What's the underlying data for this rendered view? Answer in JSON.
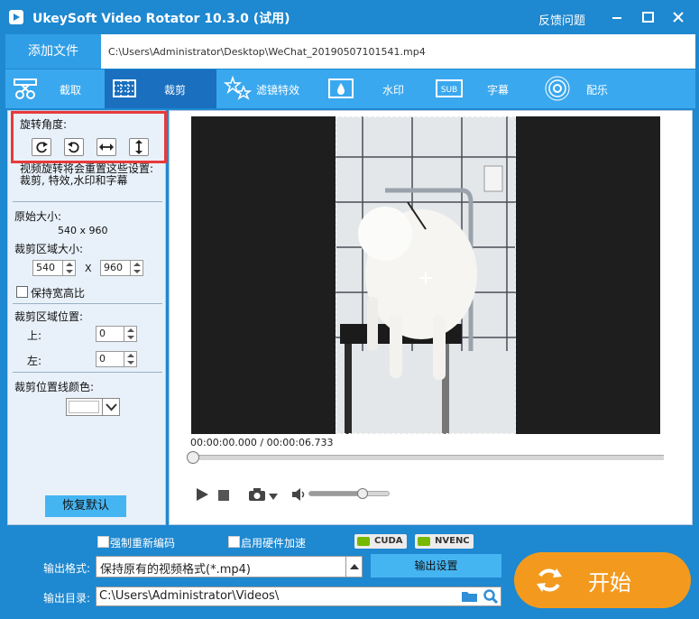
{
  "window": {
    "title": "UkeySoft Video Rotator 10.3.0 (试用)",
    "feedback": "反馈问题"
  },
  "file": {
    "add_label": "添加文件",
    "path": "C:\\Users\\Administrator\\Desktop\\WeChat_20190507101541.mp4"
  },
  "toolbar": {
    "tabs": [
      {
        "label": "截取",
        "icon": "film-scissors-icon"
      },
      {
        "label": "裁剪",
        "icon": "crop-icon",
        "active": true
      },
      {
        "label": "滤镜特效",
        "icon": "sparkle-effects-icon"
      },
      {
        "label": "水印",
        "icon": "water-drop-icon"
      },
      {
        "label": "字幕",
        "icon": "subtitle-icon"
      },
      {
        "label": "配乐",
        "icon": "music-icon"
      }
    ]
  },
  "left": {
    "rotation_label": "旋转角度:",
    "rotation_note_1": "视频旋转将会重置这些设置:",
    "rotation_note_2": "裁剪, 特效,水印和字幕",
    "original_size_label": "原始大小:",
    "original_size_value": "540 x 960",
    "crop_area_size_label": "裁剪区域大小:",
    "crop_width": "540",
    "crop_x": "X",
    "crop_height": "960",
    "keep_ratio_label": "保持宽高比",
    "crop_position_label": "裁剪区域位置:",
    "top_label": "上:",
    "top_value": "0",
    "left_label": "左:",
    "left_value": "0",
    "line_color_label": "裁剪位置线颜色:",
    "reset_label": "恢复默认"
  },
  "preview": {
    "timecode": "00:00:00.000 / 00:00:06.733",
    "volume_level": 0.67
  },
  "bottom": {
    "force_reencode": "强制重新编码",
    "hw_accel": "启用硬件加速",
    "cuda": "CUDA",
    "nvenc": "NVENC",
    "format_label": "输出格式:",
    "format_value": "保持原有的视频格式(*.mp4)",
    "output_settings": "输出设置",
    "outdir_label": "输出目录:",
    "outdir_value": "C:\\Users\\Administrator\\Videos\\",
    "start": "开始"
  },
  "colors": {
    "accent": "#1e88d0",
    "start": "#f39a1e",
    "highlight": "#e83a3a"
  }
}
